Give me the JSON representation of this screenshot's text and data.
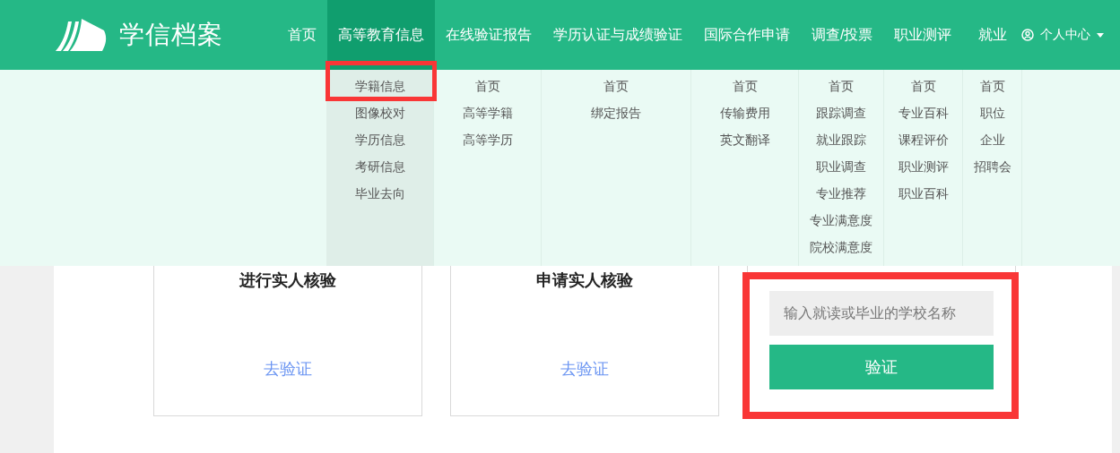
{
  "header": {
    "logo": "学信档案",
    "nav": [
      {
        "label": "首页",
        "selected": false
      },
      {
        "label": "高等教育信息",
        "selected": true
      },
      {
        "label": "在线验证报告",
        "selected": false
      },
      {
        "label": "学历认证与成绩验证",
        "selected": false
      },
      {
        "label": "国际合作申请",
        "selected": false
      },
      {
        "label": "调查/投票",
        "selected": false
      },
      {
        "label": "职业测评",
        "selected": false
      },
      {
        "label": "就业",
        "selected": false
      }
    ],
    "user_menu": "个人中心"
  },
  "dropdown": {
    "columns": [
      {
        "items": [
          {
            "label": "学籍信息",
            "highlighted": true
          },
          {
            "label": "图像校对",
            "highlighted": false
          },
          {
            "label": "学历信息",
            "highlighted": false
          },
          {
            "label": "考研信息",
            "highlighted": false
          },
          {
            "label": "毕业去向",
            "highlighted": false
          }
        ]
      },
      {
        "items": [
          {
            "label": "首页",
            "highlighted": false
          },
          {
            "label": "高等学籍",
            "highlighted": false
          },
          {
            "label": "高等学历",
            "highlighted": false
          }
        ]
      },
      {
        "items": [
          {
            "label": "首页",
            "highlighted": false
          },
          {
            "label": "绑定报告",
            "highlighted": false
          }
        ]
      },
      {
        "items": [
          {
            "label": "首页",
            "highlighted": false
          },
          {
            "label": "传输费用",
            "highlighted": false
          },
          {
            "label": "英文翻译",
            "highlighted": false
          }
        ]
      },
      {
        "items": [
          {
            "label": "首页",
            "highlighted": false
          },
          {
            "label": "跟踪调查",
            "highlighted": false
          },
          {
            "label": "就业跟踪",
            "highlighted": false
          },
          {
            "label": "职业调查",
            "highlighted": false
          },
          {
            "label": "专业推荐",
            "highlighted": false
          },
          {
            "label": "专业满意度",
            "highlighted": false
          },
          {
            "label": "院校满意度",
            "highlighted": false
          }
        ]
      },
      {
        "items": [
          {
            "label": "首页",
            "highlighted": false
          },
          {
            "label": "专业百科",
            "highlighted": false
          },
          {
            "label": "课程评价",
            "highlighted": false
          },
          {
            "label": "职业测评",
            "highlighted": false
          },
          {
            "label": "职业百科",
            "highlighted": false
          }
        ]
      },
      {
        "items": [
          {
            "label": "首页",
            "highlighted": false
          },
          {
            "label": "职位",
            "highlighted": false
          },
          {
            "label": "企业",
            "highlighted": false
          },
          {
            "label": "招聘会",
            "highlighted": false
          }
        ]
      }
    ]
  },
  "cards": [
    {
      "kind": "link",
      "title": "进行实人核验",
      "link": "去验证",
      "highlighted": false
    },
    {
      "kind": "link",
      "title": "申请实人核验",
      "link": "去验证",
      "highlighted": false
    },
    {
      "kind": "form",
      "placeholder": "输入就读或毕业的学校名称",
      "button": "验证",
      "highlighted": true
    }
  ]
}
